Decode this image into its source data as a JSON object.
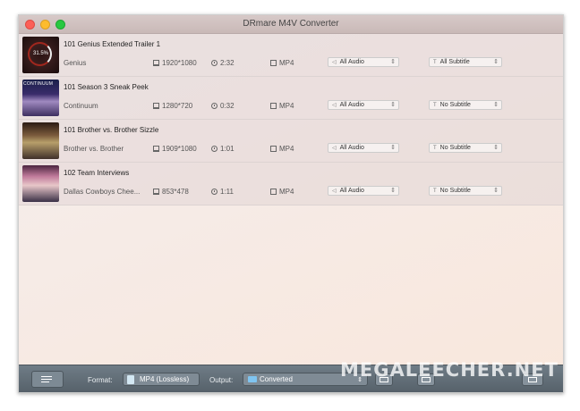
{
  "window": {
    "title": "DRmare M4V Converter"
  },
  "items": [
    {
      "thumb_text": "31.5%",
      "name": "101 Genius Extended Trailer  1",
      "sub": "Genius",
      "resolution": "1920*1080",
      "duration": "2:32",
      "format": "MP4",
      "audio": "All Audio",
      "subtitle": "All Subtitle"
    },
    {
      "thumb_text": "CONTINUUM",
      "name": "101 Season 3 Sneak Peek",
      "sub": "Continuum",
      "resolution": "1280*720",
      "duration": "0:32",
      "format": "MP4",
      "audio": "All Audio",
      "subtitle": "No Subtitle"
    },
    {
      "thumb_text": "",
      "name": "101 Brother vs. Brother Sizzle",
      "sub": "Brother vs. Brother",
      "resolution": "1909*1080",
      "duration": "1:01",
      "format": "MP4",
      "audio": "All Audio",
      "subtitle": "No Subtitle"
    },
    {
      "thumb_text": "",
      "name": "102 Team Interviews",
      "sub": "Dallas Cowboys Chee...",
      "resolution": "853*478",
      "duration": "1:11",
      "format": "MP4",
      "audio": "All Audio",
      "subtitle": "No Subtitle"
    }
  ],
  "bottom": {
    "format_label": "Format:",
    "format_value": "MP4 (Lossless)",
    "output_label": "Output:",
    "output_value": "Converted"
  },
  "watermark": "MEGALEECHER.NET",
  "colors": {
    "accent_progress": "#a1271e",
    "bottom_bar": "#56616a"
  },
  "icons": [
    "add-files-icon",
    "monitor-icon",
    "clock-icon",
    "file-icon",
    "speaker-icon",
    "text-icon",
    "folder-icon",
    "open-folder-icon",
    "history-icon",
    "convert-icon"
  ]
}
